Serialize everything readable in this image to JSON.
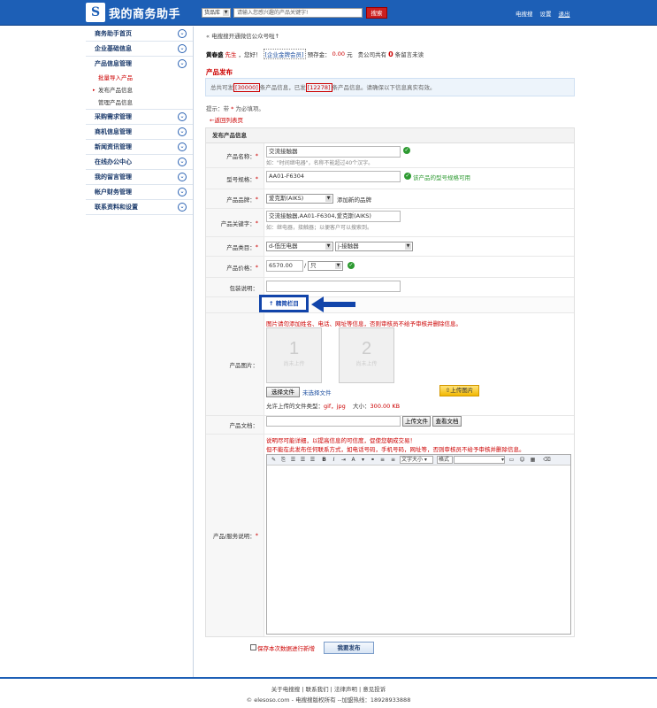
{
  "header": {
    "logo_mark": "S",
    "logo_text": "我的商务助手",
    "search_category": "货品库",
    "search_placeholder": "请输入您感兴趣的产品关键字!",
    "search_button": "搜索",
    "links": [
      "电搜搜",
      "设置",
      "退出"
    ]
  },
  "sidebar": {
    "items": [
      {
        "label": "商务助手首页"
      },
      {
        "label": "企业基础信息"
      },
      {
        "label": "产品信息管理"
      },
      {
        "label": "采购需求管理"
      },
      {
        "label": "商机信息管理"
      },
      {
        "label": "新闻资讯管理"
      },
      {
        "label": "在线办公中心"
      },
      {
        "label": "我的留言管理"
      },
      {
        "label": "帐户财务管理"
      },
      {
        "label": "联系资料和设置"
      }
    ],
    "sub_items": [
      "批量导入产品",
      "发布产品信息",
      "管理产品信息"
    ]
  },
  "breadcrumb": "电搜搜开通微信公众号啦↑",
  "user": {
    "name": "黄春盛",
    "title": "先生",
    "greeting": "，您好！",
    "level": "[企业金牌会员]",
    "deposit_label": "预存金：",
    "deposit": "0.00",
    "deposit_unit": "元",
    "msg_label": "贵公司共有",
    "msg_count": "0",
    "msg_suffix": "条留言未读"
  },
  "section_title": "产品发布",
  "quota": {
    "prefix": "总共可发",
    "total": "[30000]",
    "mid": "条产品信息，已发",
    "used": "[12278]",
    "suffix": "条产品信息。请确保以下信息真实有效。"
  },
  "tip": {
    "text": "提示：带",
    "star": "*",
    "suffix": "为必填项。"
  },
  "back_link": "←返回列表页",
  "form": {
    "title": "发布产品信息",
    "name_label": "产品名称：",
    "name_value": "交流接触器",
    "name_hint": "如：\"时间继电器\"，名称不能超过40个汉字。",
    "model_label": "型号规格：",
    "model_value": "AA01-F6304",
    "model_ok": "该产品的型号规格可用",
    "brand_label": "产品品牌：",
    "brand_value": "爱克斯(AIKS)",
    "brand_add": "添加新的品牌",
    "keywords_label": "产品关键字：",
    "keywords_value": "交流接触器,AA01-F6304,爱克斯(AIKS)",
    "keywords_hint": "如：继电器，接触器；以便客户可以搜索到。",
    "category_label": "产品类目：",
    "category_1": "d-低压电器",
    "category_2": "j-接触器",
    "price_label": "产品价格：",
    "price_value": "6570.00",
    "price_sep": "/",
    "price_unit": "只",
    "package_label": "包装说明：",
    "hide_button": "↑ 精简栏目",
    "image_warning": "图片请勿添加姓名、电话、网址等信息，否则审核员不给予审核并删除信息。",
    "image_label": "产品图片：",
    "slots": [
      {
        "n": "1",
        "t": "尚未上传"
      },
      {
        "n": "2",
        "t": "尚未上传"
      }
    ],
    "choose_file": "选择文件",
    "no_file": "未选择文件",
    "upload_image": "上传图片",
    "types_label": "允许上传的文件类型：",
    "types_value": "gif，jpg",
    "size_label": "大小：",
    "size_value": "300.00 KB",
    "doc_label": "产品文档：",
    "upload_doc": "上传文件",
    "view_doc": "查看文档",
    "desc_warn1": "说明尽可能详细，以提高信息的可信度，促使您朝成交易！",
    "desc_warn2": "但不能在此发布任何联系方式，如电话号码，手机号码，网址等，否则审核员不给予审核并删除信息。",
    "desc_label": "产品/服务说明：",
    "font_size": "文字大小",
    "format": "格式"
  },
  "submit": {
    "save_label": "保存本次数据进行新增",
    "button": "我要发布"
  },
  "footer": {
    "links": "关于电搜搜 | 联系我们 | 法律声明 | 意见投诉",
    "copyright": "© elesoso.com - 电搜搜版权所有 --加盟热线：18928933888"
  }
}
